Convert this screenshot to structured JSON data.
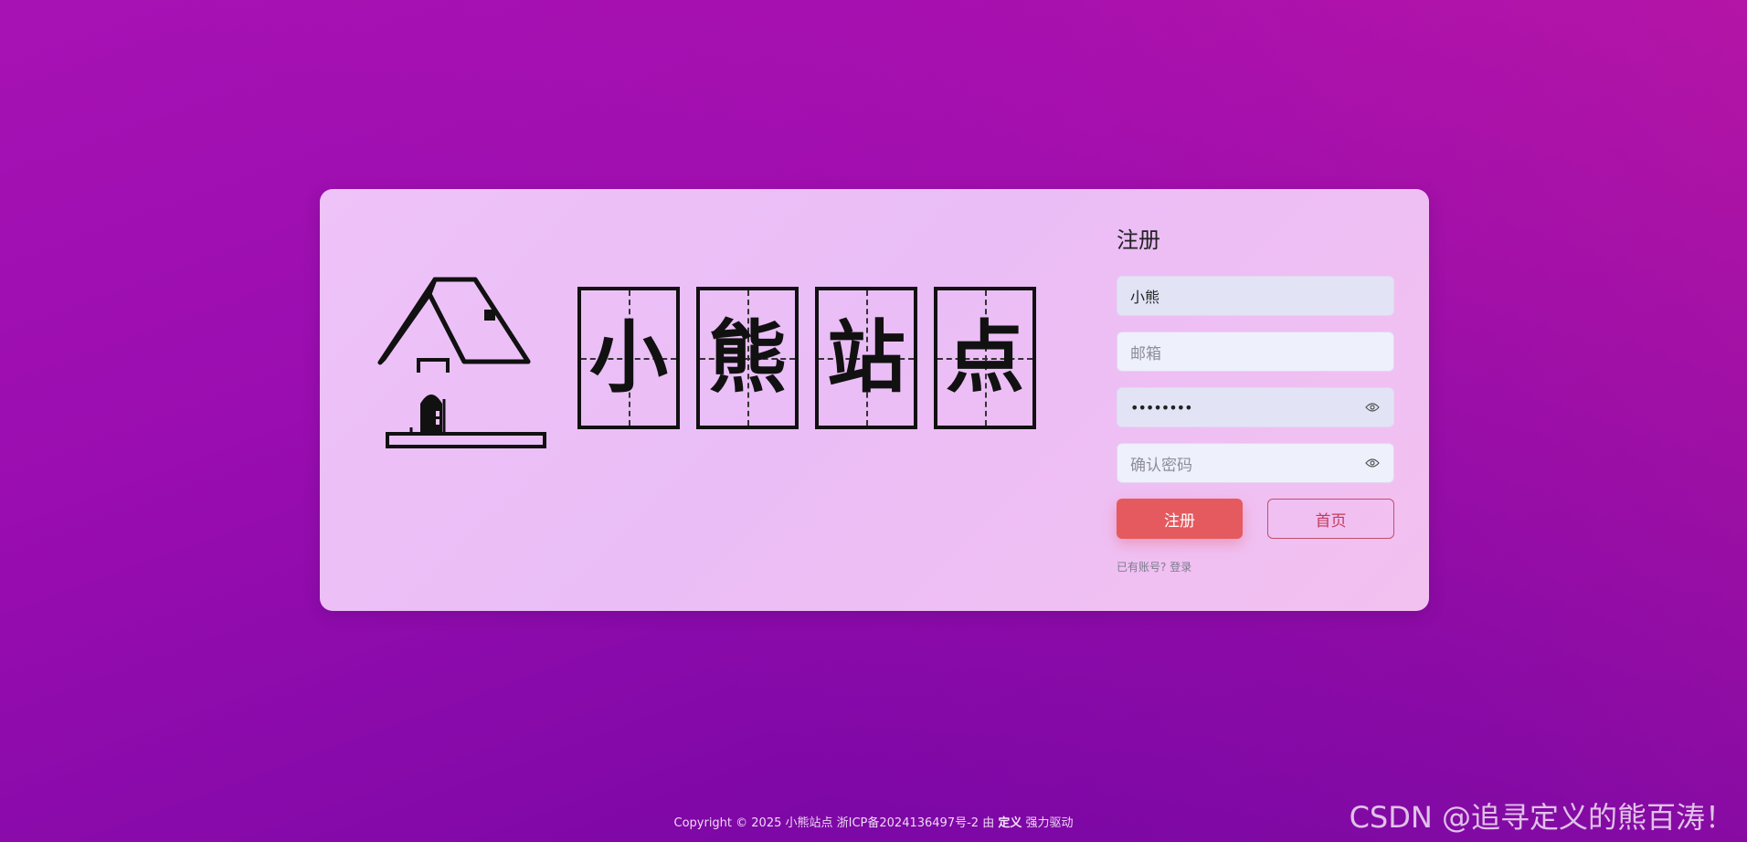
{
  "logo": {
    "house_icon": "house-icon",
    "characters": [
      "小",
      "熊",
      "站",
      "点"
    ]
  },
  "form": {
    "title": "注册",
    "username_value": "小熊",
    "email_placeholder": "邮箱",
    "password_value": "••••••••",
    "confirm_placeholder": "确认密码",
    "eye_icon": "eye-icon",
    "register_label": "注册",
    "home_label": "首页",
    "hint_text": "已有账号? ",
    "login_link": "登录"
  },
  "footer": {
    "prefix": "Copyright © 2025 小熊站点 浙ICP备2024136497号-2 由 ",
    "bold_a": "定义",
    "suffix": " 强力驱动"
  },
  "watermark": "CSDN @追寻定义的熊百涛！",
  "colors": {
    "register_button": "#e55a5f",
    "home_button_border": "#c0506a",
    "card_background": "#eec3f8",
    "page_background": "#9a0db0"
  }
}
